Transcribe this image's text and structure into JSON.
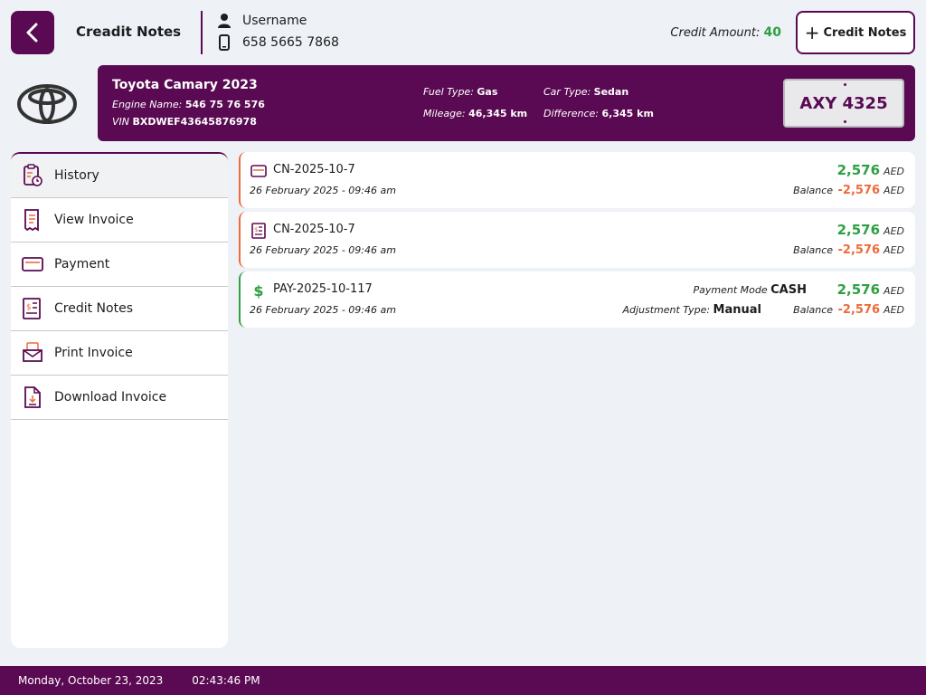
{
  "header": {
    "title": "Creadit Notes",
    "username": "Username",
    "phone": "658 5665 7868",
    "credit_amount_label": "Credit Amount:",
    "credit_amount_value": "40",
    "add_button_label": "Credit Notes"
  },
  "vehicle": {
    "name": "Toyota Camary 2023",
    "engine_label": "Engine Name:",
    "engine_value": "546 75 76 576",
    "vin_label": "VIN",
    "vin_value": "BXDWEF43645876978",
    "fuel_label": "Fuel Type:",
    "fuel_value": "Gas",
    "mileage_label": "Mileage:",
    "mileage_value": "46,345 km",
    "car_type_label": "Car Type:",
    "car_type_value": "Sedan",
    "difference_label": "Difference:",
    "difference_value": "6,345 km",
    "plate": "AXY 4325"
  },
  "sidebar": {
    "items": [
      {
        "label": "History"
      },
      {
        "label": "View Invoice"
      },
      {
        "label": "Payment"
      },
      {
        "label": "Credit Notes"
      },
      {
        "label": "Print Invoice"
      },
      {
        "label": "Download Invoice"
      }
    ]
  },
  "transactions": [
    {
      "code": "CN-2025-10-7",
      "date": "26 February 2025 - 09:46 am",
      "amount": "2,576",
      "currency": "AED",
      "balance_label": "Balance",
      "balance": "-2,576",
      "icon": "card-icon"
    },
    {
      "code": "CN-2025-10-7",
      "date": "26 February 2025 - 09:46 am",
      "amount": "2,576",
      "currency": "AED",
      "balance_label": "Balance",
      "balance": "-2,576",
      "icon": "receipt-icon"
    },
    {
      "code": "PAY-2025-10-117",
      "date": "26 February 2025 - 09:46 am",
      "amount": "2,576",
      "currency": "AED",
      "balance_label": "Balance",
      "balance": "-2,576",
      "icon": "dollar-icon",
      "payment_mode_label": "Payment Mode",
      "payment_mode": "CASH",
      "adjustment_label": "Adjustment Type:",
      "adjustment": "Manual"
    }
  ],
  "footer": {
    "date": "Monday, October 23, 2023",
    "time": "02:43:46 PM"
  },
  "colors": {
    "brand": "#5a0a52",
    "positive": "#2ea043",
    "negative": "#ee6a3a"
  }
}
